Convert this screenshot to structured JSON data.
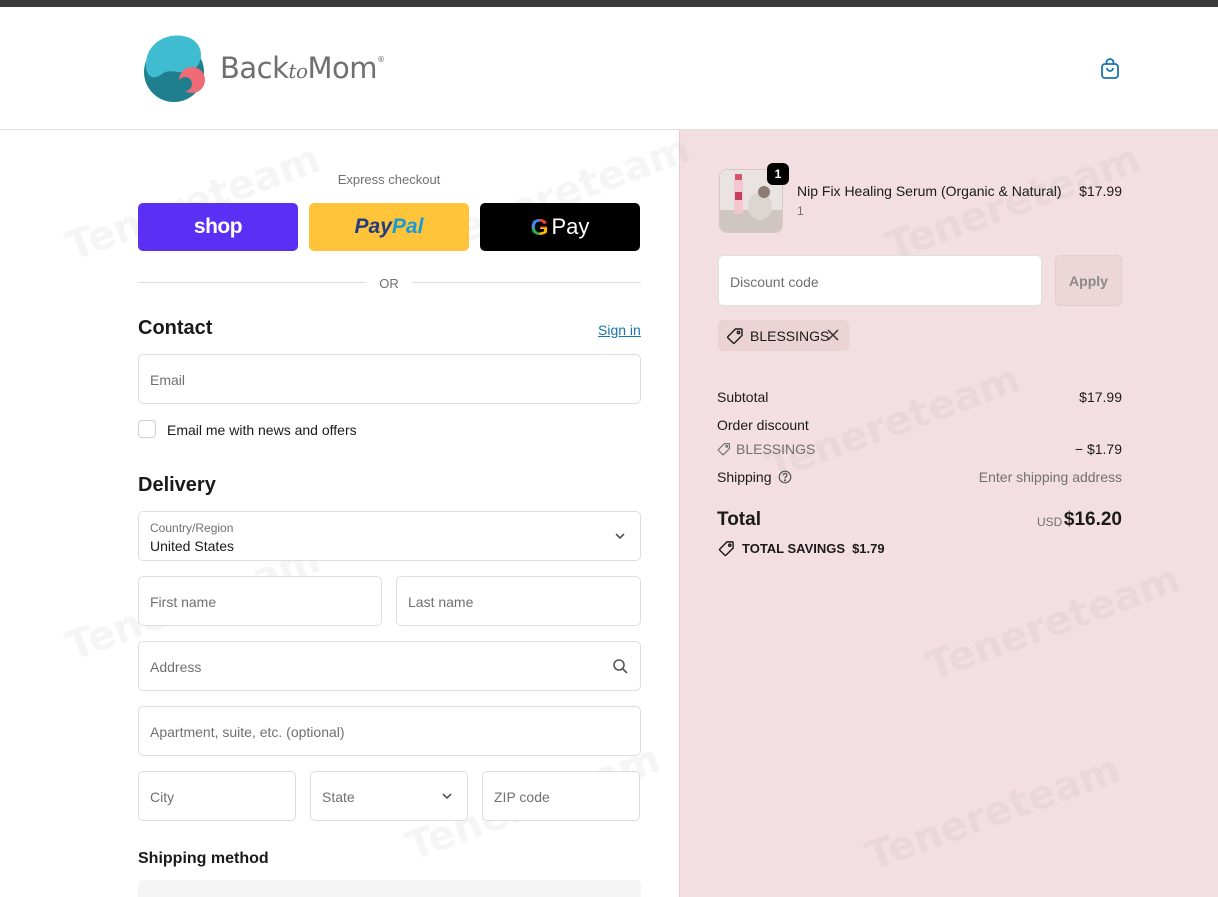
{
  "header": {
    "brand_main": "Back",
    "brand_italic": "to",
    "brand_end": "Mom",
    "brand_mark": "®",
    "cart_icon": "shopping-bag-icon"
  },
  "express": {
    "label": "Express checkout",
    "shop_label": "shop",
    "paypal_part1": "Pay",
    "paypal_part2": "Pal",
    "gpay_g": "G",
    "gpay_label": "Pay",
    "or_label": "OR"
  },
  "contact": {
    "title": "Contact",
    "signin_label": "Sign in",
    "email_placeholder": "Email",
    "newsletter_label": "Email me with news and offers"
  },
  "delivery": {
    "title": "Delivery",
    "country_label": "Country/Region",
    "country_value": "United States",
    "first_name_placeholder": "First name",
    "last_name_placeholder": "Last name",
    "address_placeholder": "Address",
    "apartment_placeholder": "Apartment, suite, etc. (optional)",
    "city_placeholder": "City",
    "state_placeholder": "State",
    "zip_placeholder": "ZIP code"
  },
  "shipping_method": {
    "title": "Shipping method"
  },
  "order": {
    "product_name": "Nip Fix Healing Serum (Organic & Natural)",
    "product_quantity": "1",
    "quantity_badge": "1",
    "product_price": "$17.99",
    "discount_placeholder": "Discount code",
    "apply_label": "Apply",
    "applied_code": "BLESSINGS",
    "subtotal_label": "Subtotal",
    "subtotal_value": "$17.99",
    "order_discount_label": "Order discount",
    "discount_code": "BLESSINGS",
    "discount_value": "− $1.79",
    "shipping_label": "Shipping",
    "shipping_value": "Enter shipping address",
    "total_label": "Total",
    "total_currency": "USD",
    "total_value": "$16.20",
    "savings_label": "TOTAL SAVINGS",
    "savings_value": "$1.79"
  },
  "colors": {
    "shop_purple": "#5a31f4",
    "paypal_yellow": "#ffc439",
    "gpay_black": "#000000",
    "summary_bg": "#f3dfe1",
    "link_blue": "#1773b0"
  },
  "watermark": "Tenereteam"
}
